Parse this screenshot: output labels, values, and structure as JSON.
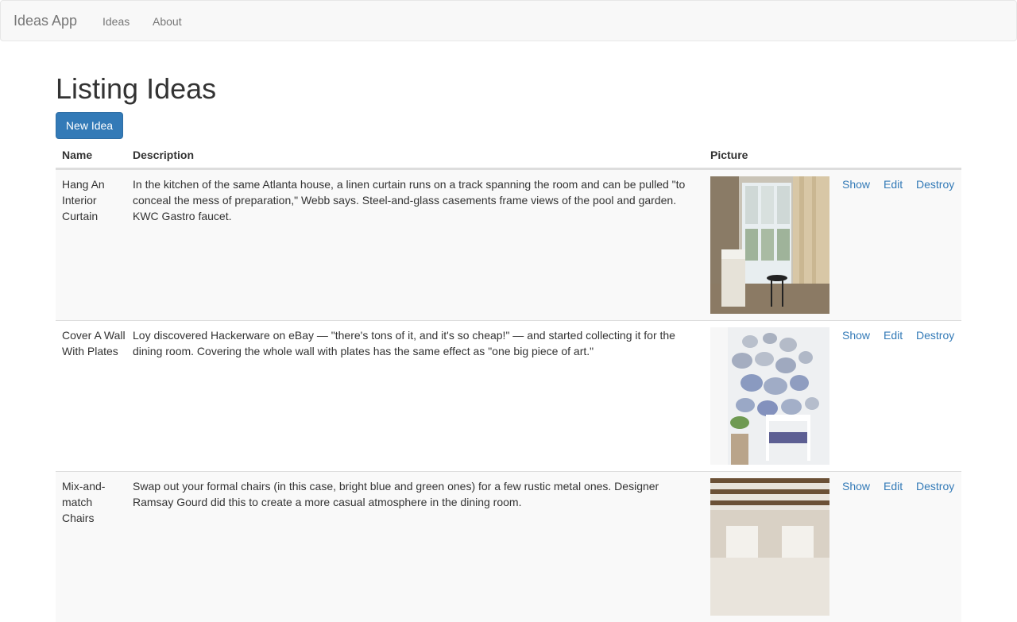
{
  "navbar": {
    "brand": "Ideas App",
    "links": [
      "Ideas",
      "About"
    ]
  },
  "page": {
    "title": "Listing Ideas",
    "new_button": "New Idea"
  },
  "table": {
    "headers": [
      "Name",
      "Description",
      "Picture"
    ],
    "rows": [
      {
        "name": "Hang An Interior Curtain",
        "description": "In the kitchen of the same Atlanta house, a linen curtain runs on a track spanning the room and can be pulled \"to conceal the mess of preparation,\" Webb says. Steel-and-glass casements frame views of the pool and garden. KWC Gastro faucet.",
        "picture": "kitchen-curtain-photo",
        "actions": [
          "Show",
          "Edit",
          "Destroy"
        ]
      },
      {
        "name": "Cover A Wall With Plates",
        "description": "Loy discovered Hackerware on eBay — \"there's tons of it, and it's so cheap!\" — and started collecting it for the dining room. Covering the whole wall with plates has the same effect as \"one big piece of art.\"",
        "picture": "plate-wall-photo",
        "actions": [
          "Show",
          "Edit",
          "Destroy"
        ]
      },
      {
        "name": "Mix-and-match Chairs",
        "description": "Swap out your formal chairs (in this case, bright blue and green ones) for a few rustic metal ones. Designer Ramsay Gourd did this to create a more casual atmosphere in the dining room.",
        "picture": "dining-chairs-photo",
        "actions": [
          "Show",
          "Edit",
          "Destroy"
        ]
      }
    ]
  },
  "colors": {
    "link": "#337ab7",
    "primary_button": "#337ab7",
    "navbar_bg": "#f8f8f8",
    "stripe_bg": "#f9f9f9"
  }
}
